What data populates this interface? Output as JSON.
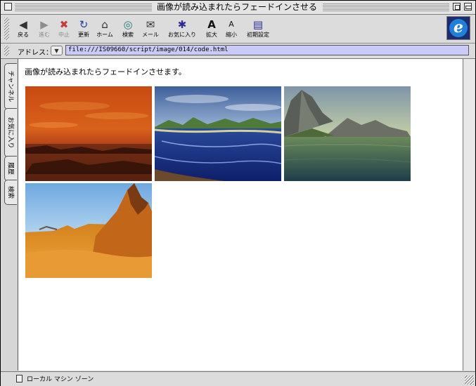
{
  "window": {
    "title": "画像が読み込まれたらフェードインさせる"
  },
  "toolbar": {
    "buttons": [
      {
        "label": "戻る",
        "icon": "back-arrow-icon",
        "glyph": "◀",
        "disabled": false
      },
      {
        "label": "進む",
        "icon": "forward-arrow-icon",
        "glyph": "▶",
        "disabled": true
      },
      {
        "label": "中止",
        "icon": "stop-icon",
        "glyph": "✖",
        "disabled": true
      },
      {
        "label": "更新",
        "icon": "refresh-icon",
        "glyph": "↻",
        "disabled": false
      },
      {
        "label": "ホーム",
        "icon": "home-icon",
        "glyph": "⌂",
        "disabled": false
      },
      {
        "label": "検索",
        "icon": "search-icon",
        "glyph": "◎",
        "disabled": false
      },
      {
        "label": "メール",
        "icon": "mail-icon",
        "glyph": "✉",
        "disabled": false
      },
      {
        "label": "お気に入り",
        "icon": "favorites-icon",
        "glyph": "✱",
        "disabled": false
      },
      {
        "label": "拡大",
        "icon": "text-larger-icon",
        "glyph": "A",
        "disabled": false
      },
      {
        "label": "縮小",
        "icon": "text-smaller-icon",
        "glyph": "A",
        "disabled": false
      },
      {
        "label": "初期設定",
        "icon": "preferences-icon",
        "glyph": "▤",
        "disabled": false
      }
    ],
    "brand_logo_letter": "e"
  },
  "address": {
    "label": "アドレス：",
    "value": "file:///IS09660/script/image/014/code.html"
  },
  "sidebar_tabs": [
    "チャンネル",
    "お気に入り",
    "履歴",
    "検索"
  ],
  "page": {
    "heading": "画像が読み込まれたらフェードインさせます。",
    "images": [
      {
        "name": "sunset-sea-image",
        "desc": "orange sunset over dark sea"
      },
      {
        "name": "blue-bay-image",
        "desc": "blue bay with green hills"
      },
      {
        "name": "rocky-coast-image",
        "desc": "rocky mountain coast over green water"
      },
      {
        "name": "desert-peak-image",
        "desc": "orange desert mountain peak"
      }
    ]
  },
  "status": {
    "text": "ローカル マシン ゾーン"
  },
  "colors": {
    "address_bg": "#c9caf7",
    "chrome": "#dcdcdc"
  }
}
